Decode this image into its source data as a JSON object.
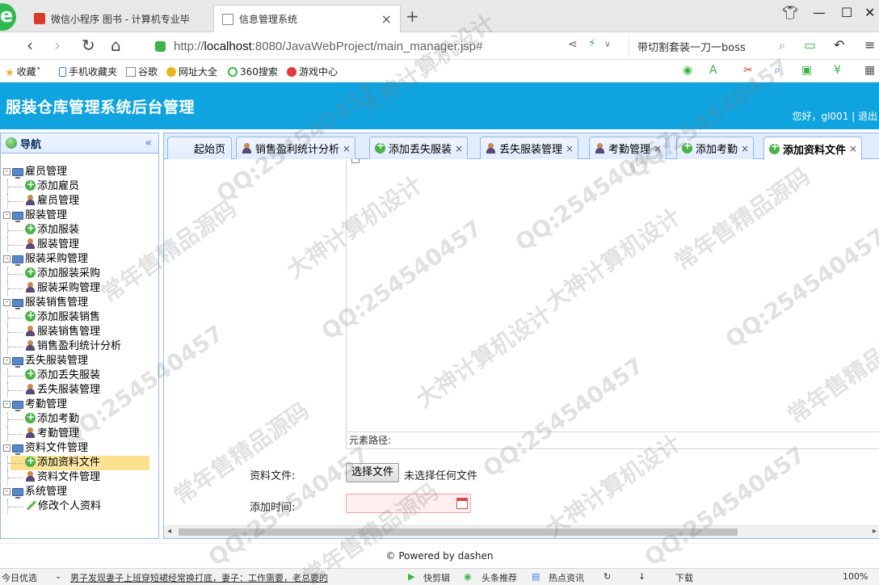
{
  "browser": {
    "tabs": [
      {
        "title": "微信小程序 图书 - 计算机专业毕"
      },
      {
        "title": "信息管理系统",
        "close": "×"
      }
    ],
    "new_tab": "+",
    "url_host": "localhost",
    "url_prefix": "http://",
    "url_rest": ":8080/JavaWebProject/main_manager.jsp#",
    "search_text": "带切割套装一刀一boss",
    "bookmarks": [
      "收藏",
      "手机收藏夹",
      "谷歌",
      "网址大全",
      "360搜索",
      "游戏中心"
    ]
  },
  "app": {
    "title": "服装仓库管理系统后台管理",
    "user_text": "您好，gl001 | 退出"
  },
  "sidebar": {
    "title": "导航",
    "collapse": "«",
    "groups": [
      {
        "label": "雇员管理",
        "items": [
          "添加雇员",
          "雇员管理"
        ]
      },
      {
        "label": "服装管理",
        "items": [
          "添加服装",
          "服装管理"
        ]
      },
      {
        "label": "服装采购管理",
        "items": [
          "添加服装采购",
          "服装采购管理"
        ]
      },
      {
        "label": "服装销售管理",
        "items": [
          "添加服装销售",
          "服装销售管理",
          "销售盈利统计分析"
        ]
      },
      {
        "label": "丢失服装管理",
        "items": [
          "添加丢失服装",
          "丢失服装管理"
        ]
      },
      {
        "label": "考勤管理",
        "items": [
          "添加考勤",
          "考勤管理"
        ]
      },
      {
        "label": "资料文件管理",
        "items": [
          "添加资料文件",
          "资料文件管理"
        ]
      },
      {
        "label": "系统管理",
        "items": [
          "修改个人资料"
        ]
      }
    ]
  },
  "tabs": [
    {
      "label": "起始页",
      "icon": "none"
    },
    {
      "label": "销售盈利统计分析",
      "icon": "user-icon"
    },
    {
      "label": "添加丢失服装",
      "icon": "add-icon"
    },
    {
      "label": "丢失服装管理",
      "icon": "user-icon"
    },
    {
      "label": "考勤管理",
      "icon": "user-icon"
    },
    {
      "label": "添加考勤",
      "icon": "add-icon"
    },
    {
      "label": "添加资料文件",
      "icon": "add-icon",
      "active": true
    }
  ],
  "tab_close": "×",
  "form": {
    "element_path": "元素路径:",
    "file_label": "资料文件:",
    "file_button": "选择文件",
    "file_none": "未选择任何文件",
    "time_label": "添加时间:",
    "time_value": ""
  },
  "footer": "© Powered by dashen",
  "statusbar": {
    "left": "今日优选",
    "news": "男子发现妻子上班穿短裙经常换打底，妻子：工作需要，老总要的",
    "items": [
      "快剪辑",
      "头条推荐",
      "热点资讯",
      "下载",
      "100%"
    ]
  },
  "watermark": {
    "qq": "QQ:254540457",
    "a": "大神计算机设计",
    "b": "常年售精品源码"
  }
}
